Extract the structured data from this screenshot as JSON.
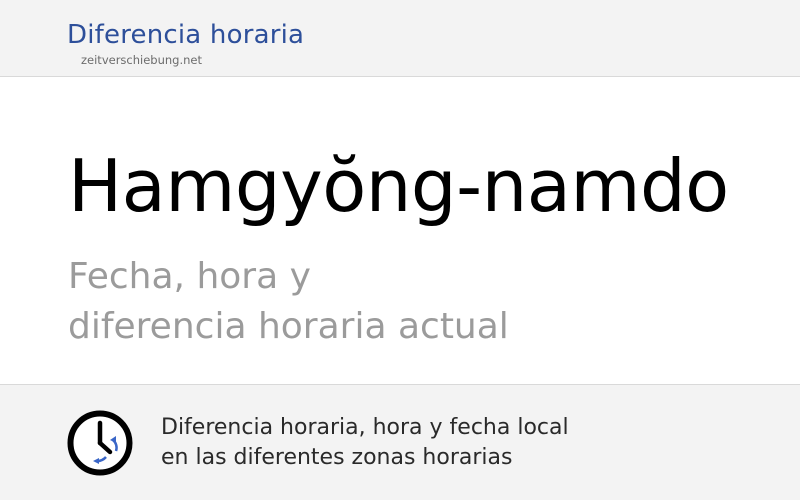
{
  "header": {
    "title": "Diferencia horaria",
    "domain": "zeitverschiebung.net"
  },
  "main": {
    "place_name": "Hamgyŏng-namdo",
    "subtitle_line1": "Fecha, hora y",
    "subtitle_line2": "diferencia horaria actual"
  },
  "footer": {
    "icon": "clock-icon",
    "line1": "Diferencia horaria, hora y fecha local",
    "line2": "en las diferentes zonas horarias"
  },
  "colors": {
    "brand": "#2d4f9a",
    "subtitle": "#9b9b9b",
    "band_background": "#f3f3f3",
    "clock_arrows": "#3a66c7"
  }
}
